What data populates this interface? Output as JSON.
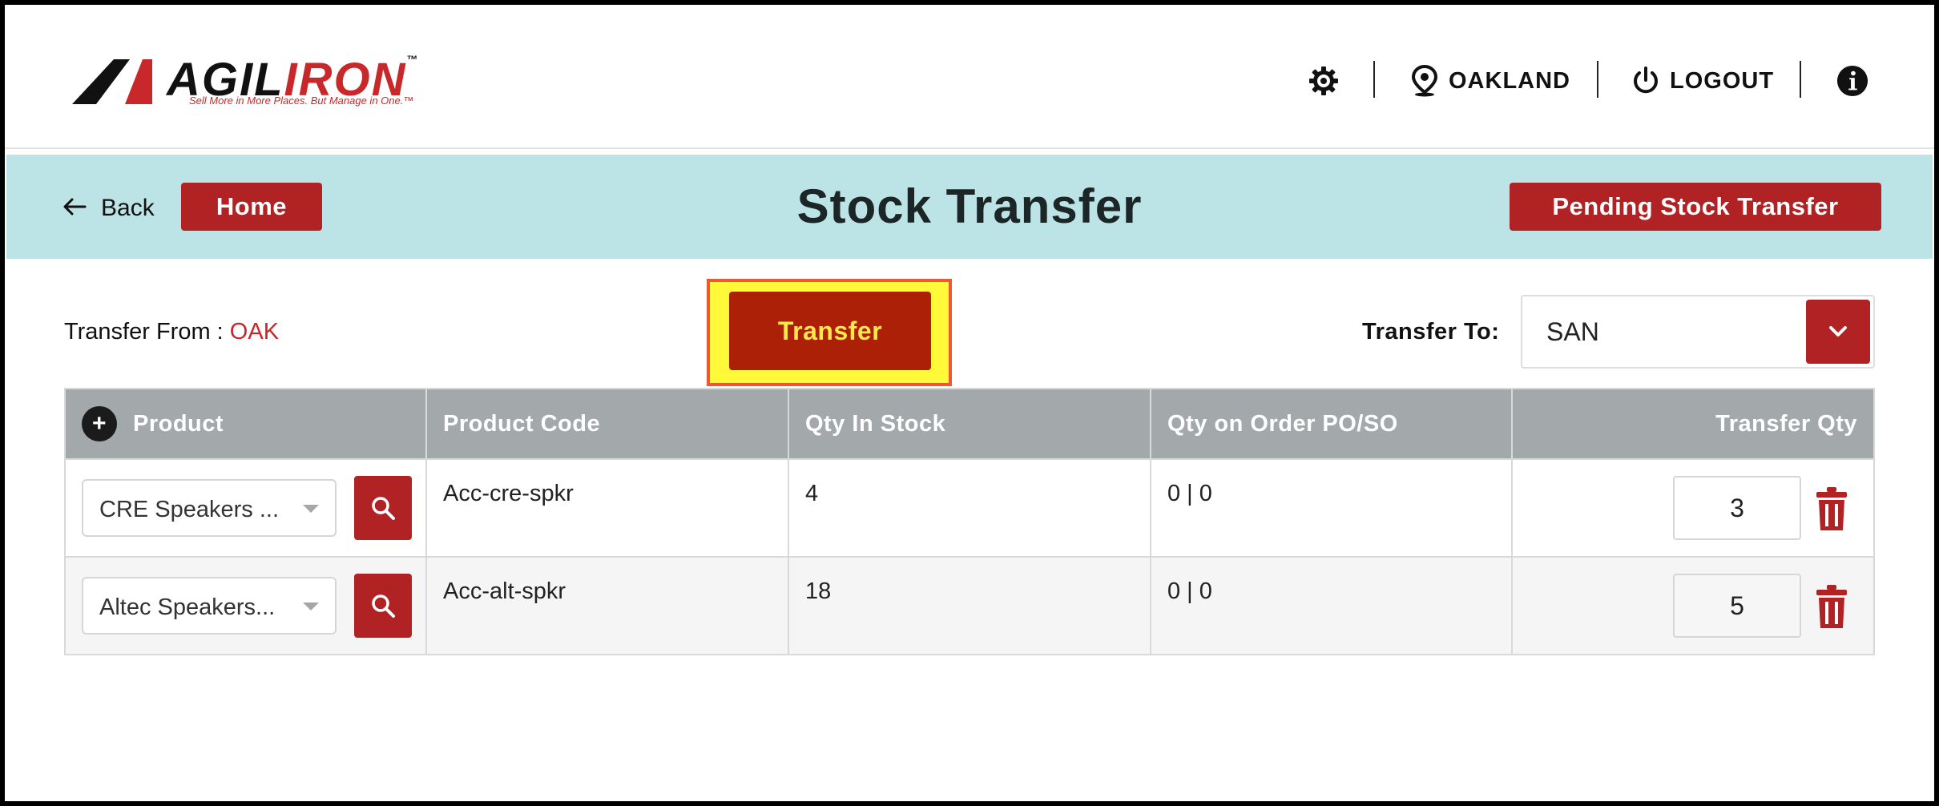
{
  "brand": {
    "name_dark": "AGIL",
    "name_red": "IRON",
    "tm": "™",
    "tagline": "Sell More in More Places. But Manage in One.™"
  },
  "topbar": {
    "location": "OAKLAND",
    "logout": "LOGOUT"
  },
  "band": {
    "back_label": "Back",
    "home_label": "Home",
    "title": "Stock Transfer",
    "pending_label": "Pending Stock Transfer"
  },
  "transfer": {
    "from_label": "Transfer From :",
    "from_value": "OAK",
    "button_label": "Transfer",
    "to_label": "Transfer To:",
    "to_value": "SAN"
  },
  "table": {
    "columns": [
      "Product",
      "Product Code",
      "Qty In Stock",
      "Qty on Order PO/SO",
      "Transfer Qty"
    ],
    "rows": [
      {
        "product": "CRE Speakers ...",
        "code": "Acc-cre-spkr",
        "qty_in_stock": "4",
        "qty_on_order": "0 | 0",
        "transfer_qty": "3"
      },
      {
        "product": "Altec Speakers...",
        "code": "Acc-alt-spkr",
        "qty_in_stock": "18",
        "qty_on_order": "0 | 0",
        "transfer_qty": "5"
      }
    ]
  },
  "colors": {
    "accent_red": "#b12224",
    "band_bg": "#bce3e6",
    "header_gray": "#a3a9ab",
    "highlight_yellow": "#fff93a",
    "highlight_border": "#f0562f"
  },
  "icons": [
    "gear-icon",
    "location-pin-icon",
    "power-icon",
    "info-icon",
    "back-arrow-icon",
    "chevron-down-icon",
    "plus-icon",
    "search-icon",
    "trash-icon"
  ]
}
